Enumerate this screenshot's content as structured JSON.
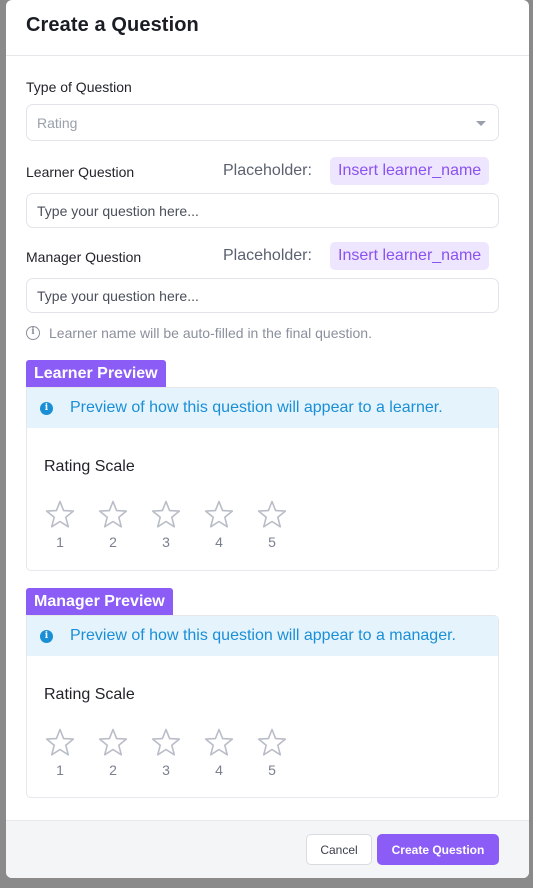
{
  "modal": {
    "title": "Create a Question"
  },
  "type_field": {
    "label": "Type of Question",
    "value": "Rating"
  },
  "learner_question": {
    "label": "Learner Question",
    "placeholder_label": "Placeholder:",
    "chip": "Insert learner_name",
    "input_placeholder": "Type your question here..."
  },
  "manager_question": {
    "label": "Manager Question",
    "placeholder_label": "Placeholder:",
    "chip": "Insert learner_name",
    "input_placeholder": "Type your question here..."
  },
  "hint": "Learner name will be auto-filled in the final question.",
  "learner_preview": {
    "tag": "Learner Preview",
    "banner": "Preview of how this question will appear to a learner.",
    "scale_title": "Rating Scale",
    "ratings": [
      "1",
      "2",
      "3",
      "4",
      "5"
    ]
  },
  "manager_preview": {
    "tag": "Manager Preview",
    "banner": "Preview of how this question will appear to a manager.",
    "scale_title": "Rating Scale",
    "ratings": [
      "1",
      "2",
      "3",
      "4",
      "5"
    ]
  },
  "footer": {
    "cancel_label": "Cancel",
    "create_label": "Create Question"
  },
  "colors": {
    "accent": "#8b5cf6",
    "chip_bg": "#eee5fe",
    "banner_bg": "#e5f3fd",
    "banner_text": "#1a8fd6"
  },
  "icons": {
    "info": "info-icon",
    "star": "star-icon",
    "caret": "chevron-down-icon"
  }
}
